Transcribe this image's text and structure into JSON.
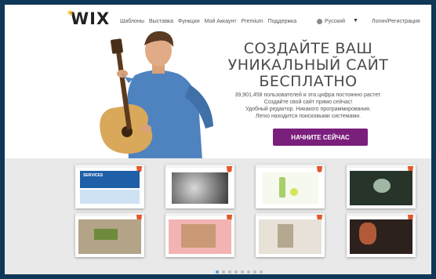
{
  "nav": {
    "logo_text": "WIX",
    "items": [
      "Шаблоны",
      "Выставка",
      "Функции",
      "Мой Аккаунт",
      "Premium",
      "Поддержка"
    ],
    "language": "Русский",
    "login": "Логин/Регистрация"
  },
  "hero": {
    "title_lines": [
      "СОЗДАЙТЕ ВАШ",
      "УНИКАЛЬНЫЙ САЙТ",
      "БЕСПЛАТНО"
    ],
    "subtitle_lines": [
      "39,901,458 пользователей и эта цифра постоянно растет.",
      "Создайте свой сайт прямо сейчас!",
      "Удобный редактор. Никакого программирования.",
      "Легко находится поисковыми системами."
    ],
    "cta_label": "НАЧНИТЕ СЕЙЧАС",
    "cta_color": "#7b1f7d"
  },
  "gallery": {
    "thumbnails": [
      {
        "header_text": "SERVICES"
      },
      {
        "header_text": ""
      },
      {
        "header_text": ""
      },
      {
        "header_text": ""
      },
      {
        "header_text": ""
      },
      {
        "header_text": ""
      },
      {
        "header_text": ""
      },
      {
        "header_text": ""
      }
    ],
    "pagination": {
      "pages": 8,
      "active": 1
    }
  }
}
